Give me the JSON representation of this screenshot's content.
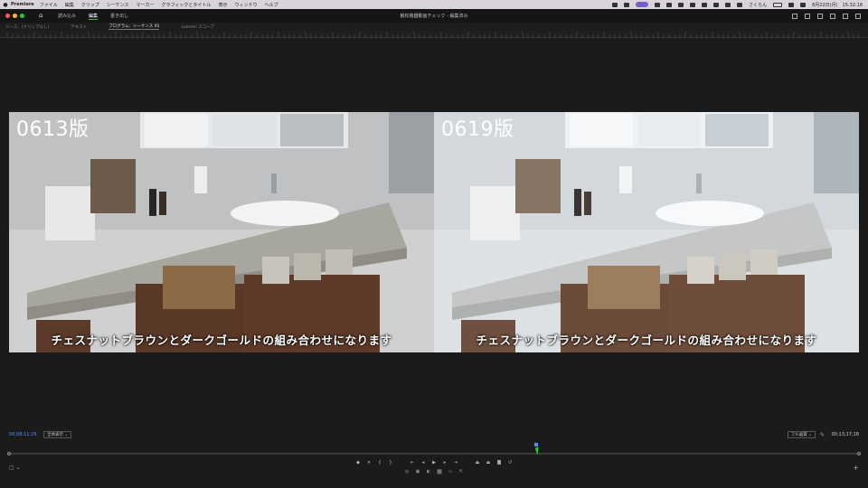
{
  "menubar": {
    "app": "Premiere",
    "items": [
      "ファイル",
      "編集",
      "クリップ",
      "シーケンス",
      "マーカー",
      "グラフィックとタイトル",
      "表示",
      "ウィンドウ",
      "ヘルプ"
    ],
    "right_user": "さくらん",
    "datetime": "8月22日(月)　15:32:18"
  },
  "header": {
    "nav": [
      "読み込み",
      "編集",
      "書き出し"
    ],
    "active_nav": "編集",
    "document_title": "観松機器動画チェック - 編集済み"
  },
  "panel_tabs": {
    "items": [
      "ソース：(クリップなし)",
      "テキスト",
      "プログラム：シーケンス 01",
      "Lumetri スコープ"
    ],
    "active": "プログラム：シーケンス 01"
  },
  "viewer": {
    "left": {
      "label": "0613版",
      "caption": "チェスナットブラウンとダークゴールドの組み合わせになります"
    },
    "right": {
      "label": "0619版",
      "caption": "チェスナットブラウンとダークゴールドの組み合わせになります"
    }
  },
  "controls": {
    "timecode_current": "00;08;11;29",
    "fit": "全体表示",
    "quality": "フル画質",
    "timecode_total": "00;13;17;18",
    "playhead_position": 0.62
  },
  "colors": {
    "accent": "#4f8fff",
    "cursor": "#2ecc40",
    "panel_bg": "#1a1b1a"
  }
}
